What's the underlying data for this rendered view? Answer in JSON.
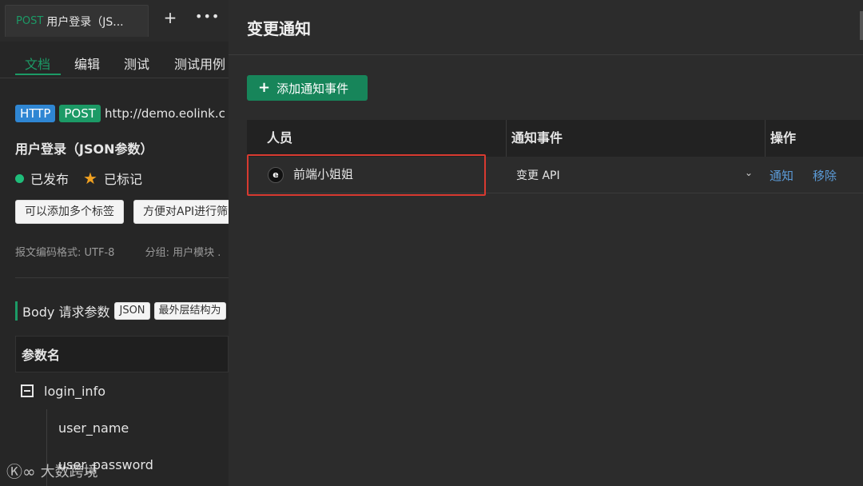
{
  "tab": {
    "method": "POST",
    "title": "用户登录（JS...",
    "add_label": "+",
    "more_label": "•••"
  },
  "subtabs": [
    "文档",
    "编辑",
    "测试",
    "测试用例"
  ],
  "api": {
    "protocol": "HTTP",
    "method": "POST",
    "url": "http://demo.eolink.c",
    "title": "用户登录（JSON参数）",
    "status": "已发布",
    "marked": "已标记",
    "tags": [
      "可以添加多个标签",
      "方便对API进行筛"
    ],
    "encoding": "报文编码格式: UTF-8",
    "group": "分组: 用户模块 ."
  },
  "body_section": {
    "label": "Body 请求参数",
    "format_tag": "JSON",
    "structure_tag": "最外层结构为"
  },
  "params": {
    "header": "参数名",
    "rows": [
      "login_info",
      "user_name",
      "user_password"
    ]
  },
  "watermark": {
    "mark": "Ⓚ∞",
    "text": "大数跨境"
  },
  "panel": {
    "title": "变更通知",
    "add_button": "添加通知事件",
    "columns": [
      "人员",
      "通知事件",
      "操作"
    ],
    "rows": [
      {
        "person": "前端小姐姐",
        "avatar_glyph": "e",
        "event": "变更 API",
        "actions": [
          "通知",
          "移除"
        ]
      }
    ]
  },
  "colors": {
    "accent": "#1c9a66",
    "link": "#5b9bd8",
    "highlight": "#d83a30"
  }
}
